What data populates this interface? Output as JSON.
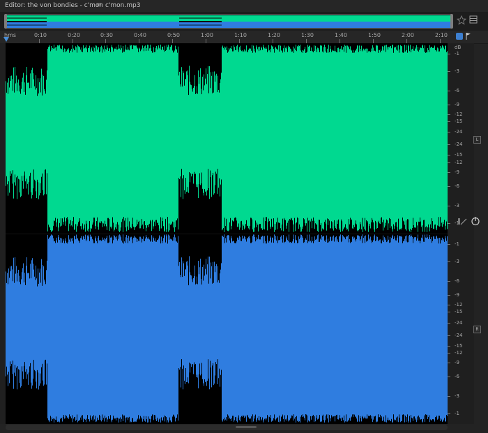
{
  "window": {
    "title": "Editor: the von bondies - c'mon c'mon.mp3",
    "menu_glyph": "≡"
  },
  "ruler": {
    "unit": "hms",
    "ticks": [
      "0:10",
      "0:20",
      "0:30",
      "0:40",
      "0:50",
      "1:00",
      "1:10",
      "1:20",
      "1:30",
      "1:40",
      "1:50",
      "2:00",
      "2:10"
    ]
  },
  "db_scale": {
    "unit": "dB",
    "top_channel_labels": [
      "-1",
      "-3",
      "-6",
      "-9",
      "-12",
      "-15",
      "-24",
      "-24",
      "-15",
      "-12",
      "-9",
      "-6",
      "-3",
      "-1"
    ],
    "bottom_channel_labels": [
      "-1",
      "-3",
      "-6",
      "-9",
      "-12",
      "-15",
      "-24",
      "-24",
      "-15",
      "-12",
      "-9",
      "-6",
      "-3",
      "-1"
    ]
  },
  "channels": {
    "left_label": "L",
    "right_label": "R",
    "left_color": "#00d990",
    "right_color": "#2f7de0"
  },
  "icons": {
    "favorite": "star-icon",
    "properties": "panel-properties-icon",
    "snap": "magnet-icon",
    "marker": "marker-flag-icon",
    "volume": "volume-slider-icon",
    "power": "power-icon"
  }
}
